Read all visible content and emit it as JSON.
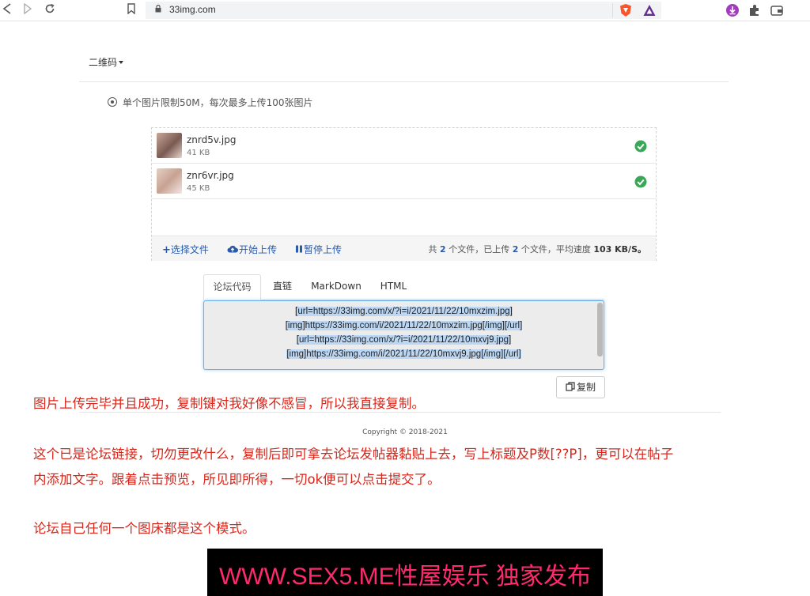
{
  "browser": {
    "url": "33img.com"
  },
  "page": {
    "dropdown_label": "二维码",
    "limit_note": "单个图片限制50M，每次最多上传100张图片",
    "files": [
      {
        "name": "znrd5v.jpg",
        "size": "41 KB"
      },
      {
        "name": "znr6vr.jpg",
        "size": "45 KB"
      }
    ],
    "toolbar": {
      "select_label": "选择文件",
      "start_label": "开始上传",
      "pause_label": "暂停上传",
      "stats_prefix": "共",
      "stats_total": "2",
      "stats_mid1": "个文件，已上传",
      "stats_done": "2",
      "stats_mid2": "个文件，平均速度",
      "stats_speed": "103 KB/S。"
    },
    "tabs": [
      "论坛代码",
      "直链",
      "MarkDown",
      "HTML"
    ],
    "code_lines": [
      "[url=https://33img.com/x/?i=i/2021/11/22/10mxzim.jpg]",
      "[img]https://33img.com/i/2021/11/22/10mxzim.jpg[/img][/url]",
      "[url=https://33img.com/x/?i=i/2021/11/22/10mxvj9.jpg]",
      "[img]https://33img.com/i/2021/11/22/10mxvj9.jpg[/img][/url]"
    ],
    "copy_label": "复制",
    "copyright": "Copyright © 2018-2021"
  },
  "annotations": {
    "line1": "图片上传完毕并且成功，复制键对我好像不感冒，所以我直接复制。",
    "line2": "这个已是论坛链接，切勿更改什么，复制后即可拿去论坛发帖器黏贴上去，写上标题及P数[??P]，更可以在帖子",
    "line3": "内添加文字。跟着点击预览，所见即所得，一切ok便可以点击提交了。",
    "line4": "论坛自己任何一个图床都是这个模式。"
  },
  "banner": {
    "text": "WWW.SEX5.ME性屋娱乐 独家发布"
  },
  "colors": {
    "accent_blue": "#2b5aa8",
    "success_green": "#3aa757",
    "annotation_red": "#d8261b",
    "banner_pink": "#ff2a6e"
  }
}
